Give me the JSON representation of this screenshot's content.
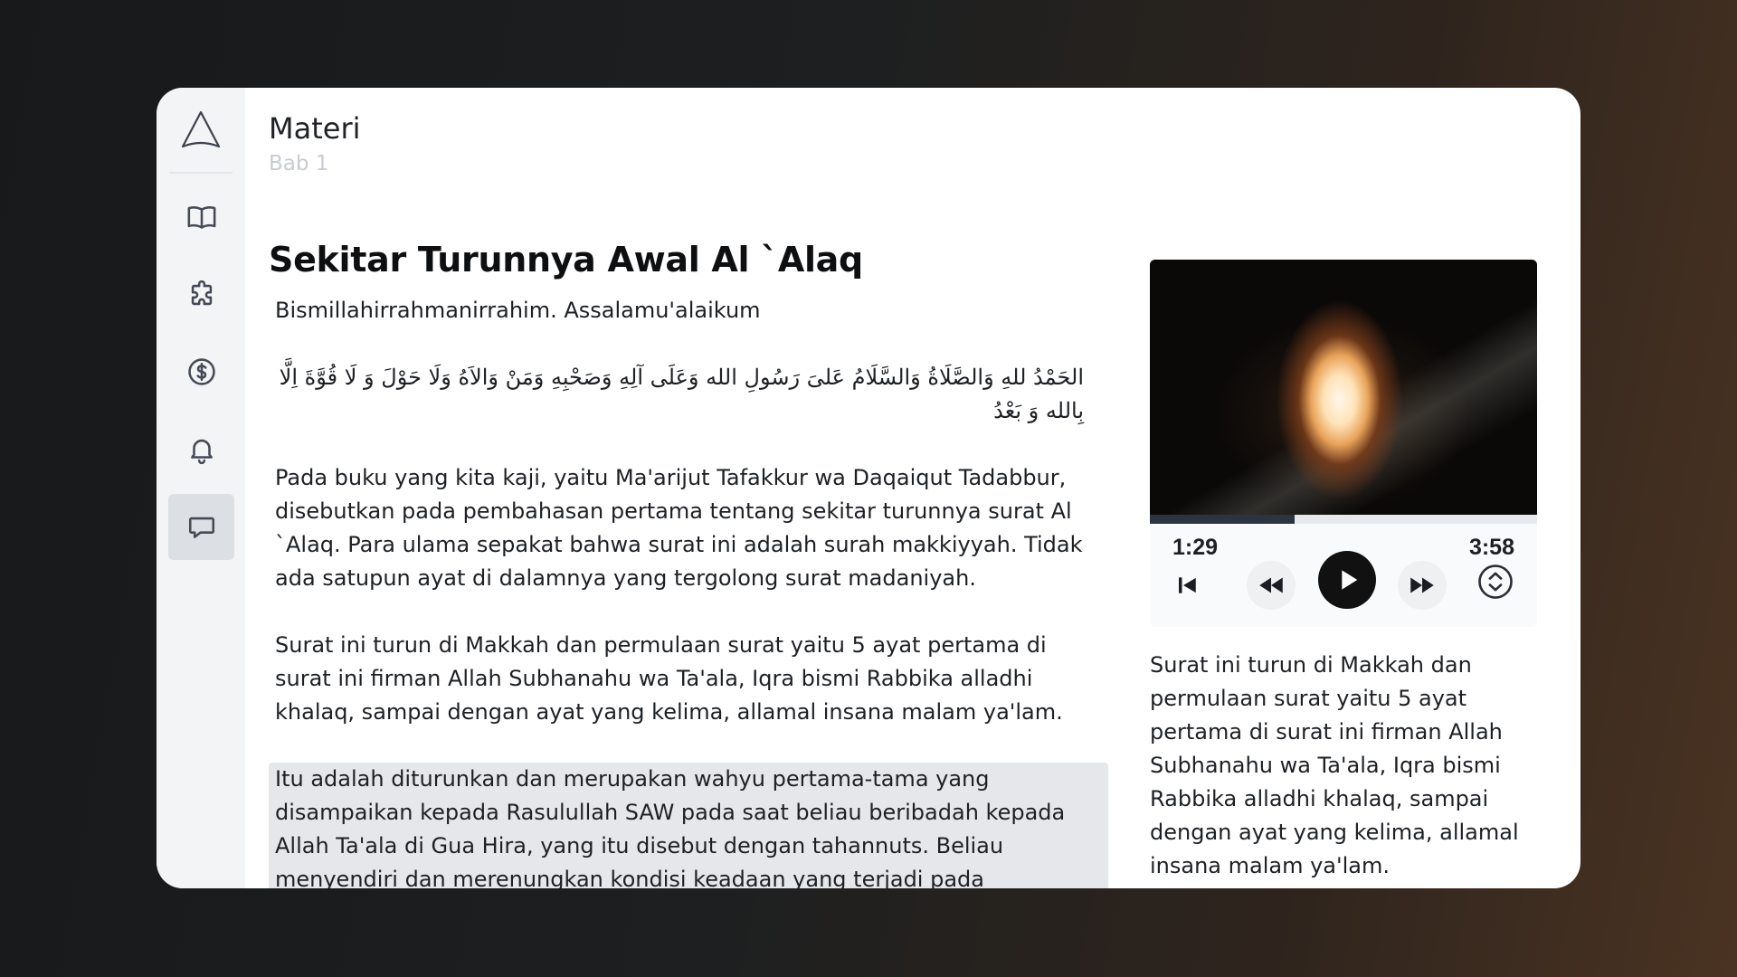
{
  "sidebar": {
    "logo_icon": "arrow-logo-icon",
    "items": [
      {
        "name": "book",
        "icon": "book-open-icon",
        "active": false
      },
      {
        "name": "puzzle",
        "icon": "puzzle-icon",
        "active": false
      },
      {
        "name": "dollar",
        "icon": "dollar-circle-icon",
        "active": false
      },
      {
        "name": "bell",
        "icon": "bell-icon",
        "active": false
      },
      {
        "name": "chat",
        "icon": "chat-bubble-icon",
        "active": true
      }
    ]
  },
  "header": {
    "title": "Materi",
    "subtitle": "Bab 1"
  },
  "article": {
    "title": "Sekitar Turunnya Awal Al `Alaq",
    "greeting": "Bismillahirrahmanirrahim. Assalamu'alaikum",
    "arabic": "الحَمْدُ للهِ وَالصَّلَاةُ وَالسَّلَامُ عَلىَ رَسُولِ الله وَعَلَى آلِهِ وَصَحْبِهِ وَمَنْ وَالاَهُ وَلَا حَوْلَ وَ لَا قُوَّةَ اِلَّا بِالله وَ بَعْدُ",
    "paragraph1": "Pada buku yang kita kaji, yaitu Ma'arijut Tafakkur wa Daqaiqut Tadabbur, disebutkan pada pembahasan pertama tentang sekitar turunnya surat Al `Alaq. Para ulama sepakat bahwa surat ini adalah surah makkiyyah. Tidak ada satupun ayat di dalamnya yang tergolong surat madaniyah.",
    "paragraph2": "Surat ini turun di Makkah dan permulaan surat yaitu 5 ayat pertama di surat ini firman Allah Subhanahu wa Ta'ala, Iqra bismi Rabbika alladhi khalaq, sampai dengan ayat yang kelima, allamal insana malam ya'lam.",
    "highlighted": "Itu adalah diturunkan dan merupakan wahyu pertama-tama yang disampaikan kepada Rasulullah SAW pada saat beliau beribadah kepada Allah Ta'ala di Gua Hira, yang itu disebut dengan tahannuts. Beliau menyendiri dan merenungkan kondisi keadaan yang terjadi pada masyarakat Makkah pada saat itu. Untuk"
  },
  "player": {
    "image_icon": "cave-light-image",
    "current_time": "1:29",
    "duration": "3:58",
    "progress": 0.373,
    "controls": [
      "skip-back-icon",
      "rewind-icon",
      "play-icon",
      "fast-forward-icon",
      "expand-icon"
    ]
  },
  "media_description": "Surat ini turun di Makkah dan permulaan surat yaitu 5 ayat pertama di surat ini firman Allah Subhanahu wa Ta'ala, Iqra bismi Rabbika alladhi khalaq,  sampai dengan ayat yang kelima,  allamal insana malam ya'lam."
}
